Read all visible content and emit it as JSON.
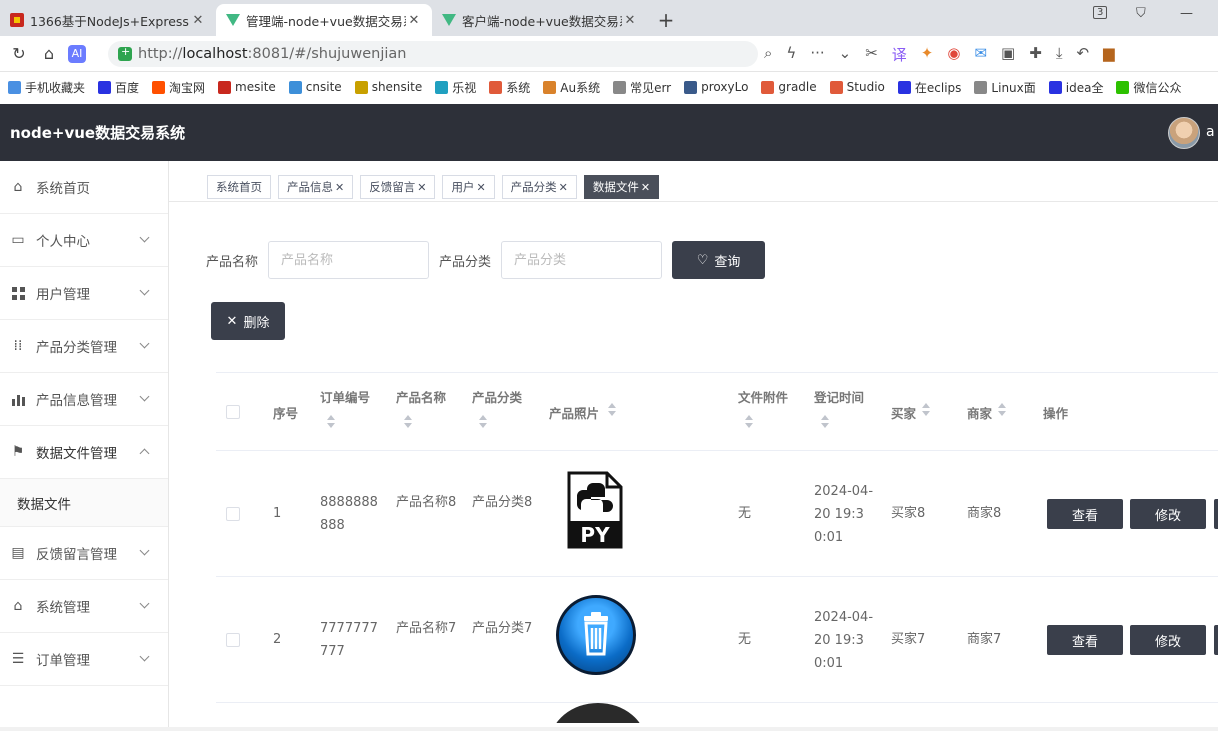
{
  "browser": {
    "tabs": [
      {
        "title": "1366基于NodeJs+Express+",
        "active": false,
        "icon": "red-square-icon"
      },
      {
        "title": "管理端-node+vue数据交易系",
        "active": true,
        "icon": "vue-icon"
      },
      {
        "title": "客户端-node+vue数据交易系",
        "active": false,
        "icon": "vue-icon"
      }
    ],
    "tab_count_badge": "3",
    "url_prefix": "http://",
    "url_host": "localhost",
    "url_path": ":8081/#/shujuwenjian",
    "bookmarks": [
      {
        "label": "手机收藏夹",
        "color": "#4a90e2"
      },
      {
        "label": "百度",
        "color": "#2932e1"
      },
      {
        "label": "淘宝网",
        "color": "#ff5000"
      },
      {
        "label": "mesite",
        "color": "#c8281e"
      },
      {
        "label": "cnsite",
        "color": "#3d8fd9"
      },
      {
        "label": "shensite",
        "color": "#c8a000"
      },
      {
        "label": "乐视",
        "color": "#20a0c0"
      },
      {
        "label": "系统",
        "color": "#e05a3a"
      },
      {
        "label": "Au系统",
        "color": "#d9822b"
      },
      {
        "label": "常见err",
        "color": "#888888"
      },
      {
        "label": "proxyLo",
        "color": "#3a5a8a"
      },
      {
        "label": "gradle",
        "color": "#e05a3a"
      },
      {
        "label": "Studio",
        "color": "#e05a3a"
      },
      {
        "label": "在eclips",
        "color": "#2932e1"
      },
      {
        "label": "Linux面",
        "color": "#888888"
      },
      {
        "label": "idea全",
        "color": "#2932e1"
      },
      {
        "label": "微信公众",
        "color": "#2dc100"
      }
    ]
  },
  "app": {
    "title": "node+vue数据交易系统",
    "user_initial": "a"
  },
  "sidebar": {
    "items": [
      {
        "label": "系统首页",
        "icon": "home-icon",
        "expandable": false
      },
      {
        "label": "个人中心",
        "icon": "id-card-icon",
        "expandable": true
      },
      {
        "label": "用户管理",
        "icon": "grid-icon",
        "expandable": true
      },
      {
        "label": "产品分类管理",
        "icon": "apps-icon",
        "expandable": true
      },
      {
        "label": "产品信息管理",
        "icon": "bar-chart-icon",
        "expandable": true
      },
      {
        "label": "数据文件管理",
        "icon": "flag-icon",
        "expandable": true,
        "open": true
      }
    ],
    "submenu": {
      "label": "数据文件"
    },
    "items_after": [
      {
        "label": "反馈留言管理",
        "icon": "clipboard-icon",
        "expandable": true
      },
      {
        "label": "系统管理",
        "icon": "tools-icon",
        "expandable": true
      },
      {
        "label": "订单管理",
        "icon": "list-icon",
        "expandable": true
      }
    ]
  },
  "tags": [
    {
      "label": "系统首页",
      "closable": false,
      "active": false
    },
    {
      "label": "产品信息",
      "closable": true,
      "active": false
    },
    {
      "label": "反馈留言",
      "closable": true,
      "active": false
    },
    {
      "label": "用户",
      "closable": true,
      "active": false
    },
    {
      "label": "产品分类",
      "closable": true,
      "active": false
    },
    {
      "label": "数据文件",
      "closable": true,
      "active": true
    }
  ],
  "search": {
    "name_label": "产品名称",
    "name_placeholder": "产品名称",
    "category_label": "产品分类",
    "category_placeholder": "产品分类",
    "query_button": "查询",
    "delete_button": "删除"
  },
  "table": {
    "headers": {
      "index": "序号",
      "order_no": "订单编号",
      "product_name": "产品名称",
      "category": "产品分类",
      "photo": "产品照片",
      "attachment": "文件附件",
      "reg_time": "登记时间",
      "buyer": "买家",
      "merchant": "商家",
      "actions": "操作"
    },
    "rows": [
      {
        "index": "1",
        "order_no": "8888888888",
        "product_name": "产品名称8",
        "category": "产品分类8",
        "photo": "python-file-icon",
        "photo_text": "PY",
        "attachment": "无",
        "reg_time": "2024-04-20 19:30:01",
        "buyer": "买家8",
        "merchant": "商家8"
      },
      {
        "index": "2",
        "order_no": "7777777777",
        "product_name": "产品名称7",
        "category": "产品分类7",
        "photo": "trash-icon",
        "attachment": "无",
        "reg_time": "2024-04-20 19:30:01",
        "buyer": "买家7",
        "merchant": "商家7"
      }
    ],
    "view_button": "查看",
    "edit_button": "修改"
  }
}
